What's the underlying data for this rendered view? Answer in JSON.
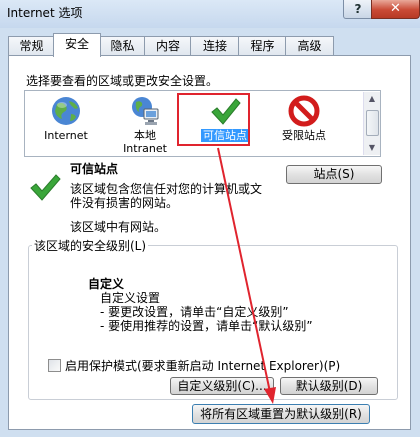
{
  "window": {
    "title": "Internet 选项",
    "help_glyph": "?",
    "close_glyph": "✕"
  },
  "tabs": [
    {
      "label": "常规"
    },
    {
      "label": "安全"
    },
    {
      "label": "隐私"
    },
    {
      "label": "内容"
    },
    {
      "label": "连接"
    },
    {
      "label": "程序"
    },
    {
      "label": "高级"
    }
  ],
  "active_tab": "安全",
  "security": {
    "prompt": "选择要查看的区域或更改安全设置。",
    "zones": [
      {
        "label": "Internet",
        "label2": "",
        "icon": "globe-icon",
        "selected": false
      },
      {
        "label": "本地",
        "label2": "Intranet",
        "icon": "local-intranet-icon",
        "selected": false
      },
      {
        "label": "可信站点",
        "label2": "",
        "icon": "trusted-sites-check-icon",
        "selected": true
      },
      {
        "label": "受限站点",
        "label2": "",
        "icon": "restricted-sites-icon",
        "selected": false
      }
    ],
    "zone_detail": {
      "title": "可信站点",
      "description": "该区域包含您信任对您的计算机或文件没有损害的网站。",
      "note": "该区域中有网站。",
      "sites_button": "站点(S)"
    },
    "level_group": {
      "legend": "该区域的安全级别(L)",
      "custom_title": "自定义",
      "custom_lines": [
        "自定义设置",
        "- 要更改设置，请单击“自定义级别”",
        "- 要使用推荐的设置，请单击“默认级别”"
      ],
      "protected_mode_label": "启用保护模式(要求重新启动 Internet Explorer)(P)",
      "protected_mode_checked": false,
      "custom_level_button": "自定义级别(C)...",
      "default_level_button": "默认级别(D)"
    },
    "reset_all_button": "将所有区域重置为默认级别(R)"
  },
  "colors": {
    "annotation_red": "#e0242e",
    "selection_blue": "#3399ff",
    "check_green": "#3aa63a"
  }
}
